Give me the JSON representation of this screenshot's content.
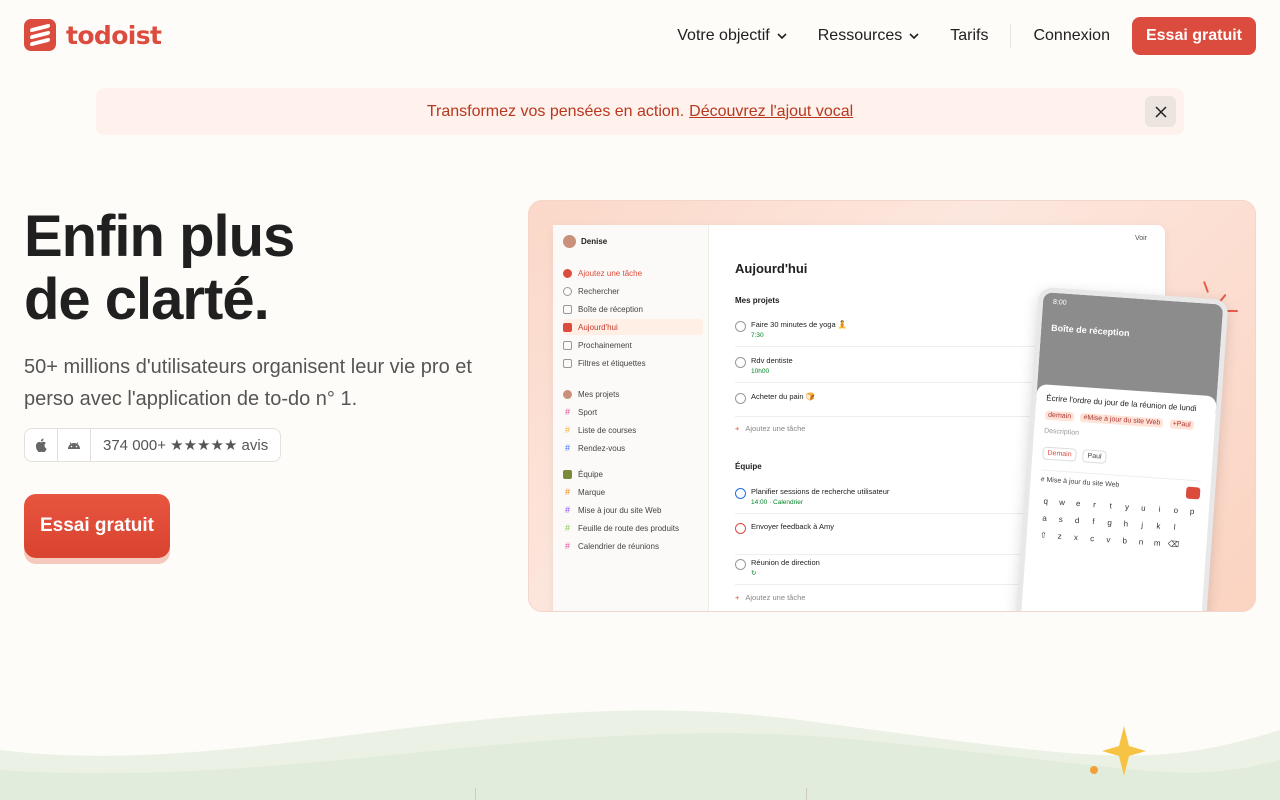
{
  "header": {
    "logo_text": "todoist",
    "nav": [
      {
        "label": "Votre objectif",
        "dropdown": true
      },
      {
        "label": "Ressources",
        "dropdown": true
      },
      {
        "label": "Tarifs",
        "dropdown": false
      }
    ],
    "login_label": "Connexion",
    "cta_label": "Essai gratuit"
  },
  "banner": {
    "text": "Transformez vos pensées en action.",
    "link": "Découvrez l'ajout vocal"
  },
  "hero": {
    "title_line1": "Enfin plus",
    "title_line2": "de clarté.",
    "subtitle": "50+ millions d'utilisateurs organisent leur vie pro et perso avec l'application de to-do n° 1.",
    "ratings_text": "374 000+ ★★★★★ avis",
    "cta_label": "Essai gratuit"
  },
  "app_preview": {
    "user": "Denise",
    "view_label": "Voir",
    "sidebar": {
      "nav": [
        {
          "label": "Ajoutez une tâche",
          "kind": "add"
        },
        {
          "label": "Rechercher",
          "kind": "normal"
        },
        {
          "label": "Boîte de réception",
          "kind": "normal"
        },
        {
          "label": "Aujourd'hui",
          "kind": "active"
        },
        {
          "label": "Prochainement",
          "kind": "normal"
        },
        {
          "label": "Filtres et étiquettes",
          "kind": "normal"
        }
      ],
      "projects_header": "Mes projets",
      "projects": [
        {
          "label": "Sport",
          "color": "#e05194"
        },
        {
          "label": "Liste de courses",
          "color": "#f2b134"
        },
        {
          "label": "Rendez-vous",
          "color": "#4073ff"
        }
      ],
      "team_header": "Équipe",
      "team_projects": [
        {
          "label": "Marque",
          "color": "#eb8909"
        },
        {
          "label": "Mise à jour du site Web",
          "color": "#884dff"
        },
        {
          "label": "Feuille de route des produits",
          "color": "#7ecc49"
        },
        {
          "label": "Calendrier de réunions",
          "color": "#e05194"
        }
      ]
    },
    "main": {
      "title": "Aujourd'hui",
      "section1": "Mes projets",
      "tasks1": [
        {
          "title": "Faire 30 minutes de yoga 🧘",
          "meta": "7:30"
        },
        {
          "title": "Rdv dentiste",
          "meta": "10h00"
        },
        {
          "title": "Acheter du pain 🍞",
          "meta": ""
        }
      ],
      "add_task": "Ajoutez une tâche",
      "section2": "Équipe",
      "tasks2": [
        {
          "title": "Planifier sessions de recherche utilisateur",
          "meta": "14:00 · Calendrier",
          "circle": "blue"
        },
        {
          "title": "Envoyer feedback à Amy",
          "meta": "",
          "circle": "red"
        },
        {
          "title": "Réunion de direction",
          "meta": "",
          "circle": "gray"
        }
      ]
    },
    "phone": {
      "time": "8:00",
      "header": "Boîte de réception",
      "task_text": "Écrire l'ordre du jour de la réunion de lundi",
      "tags": [
        "demain",
        "#Mise à jour du site Web",
        "+Paul"
      ],
      "description": "Description",
      "chip_date": "Demain",
      "chip_person": "Paul",
      "project": "# Mise à jour du site Web",
      "keys": [
        "q",
        "w",
        "e",
        "r",
        "t",
        "y",
        "u",
        "i",
        "o",
        "p",
        "a",
        "s",
        "d",
        "f",
        "g",
        "h",
        "j",
        "k",
        "l",
        "",
        "⇧",
        "z",
        "x",
        "c",
        "v",
        "b",
        "n",
        "m",
        "⌫",
        ""
      ]
    }
  },
  "colors": {
    "brand": "#dc4c3e",
    "banner_bg": "#fff1ec",
    "page_bg": "#fefcf9"
  }
}
